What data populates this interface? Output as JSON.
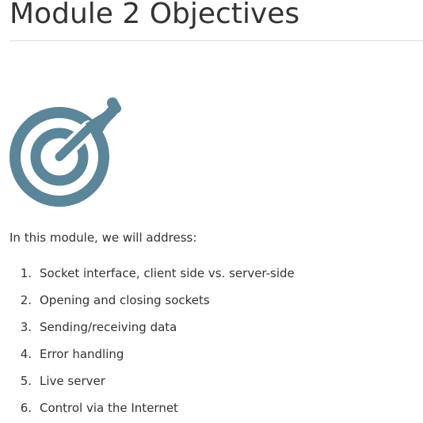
{
  "page": {
    "title": "Module 2 Objectives",
    "intro": "In this module, we will address:"
  },
  "icon": {
    "name": "target-dart-icon",
    "color": "#5b8599"
  },
  "objectives": [
    {
      "number": "1.",
      "text": "Socket interface, client side vs. server-side"
    },
    {
      "number": "2.",
      "text": "Opening and closing sockets"
    },
    {
      "number": "3.",
      "text": "Sending/receiving data"
    },
    {
      "number": "4.",
      "text": "Error handling"
    },
    {
      "number": "5.",
      "text": "Live server"
    },
    {
      "number": "6.",
      "text": "Control via the Internet"
    }
  ]
}
